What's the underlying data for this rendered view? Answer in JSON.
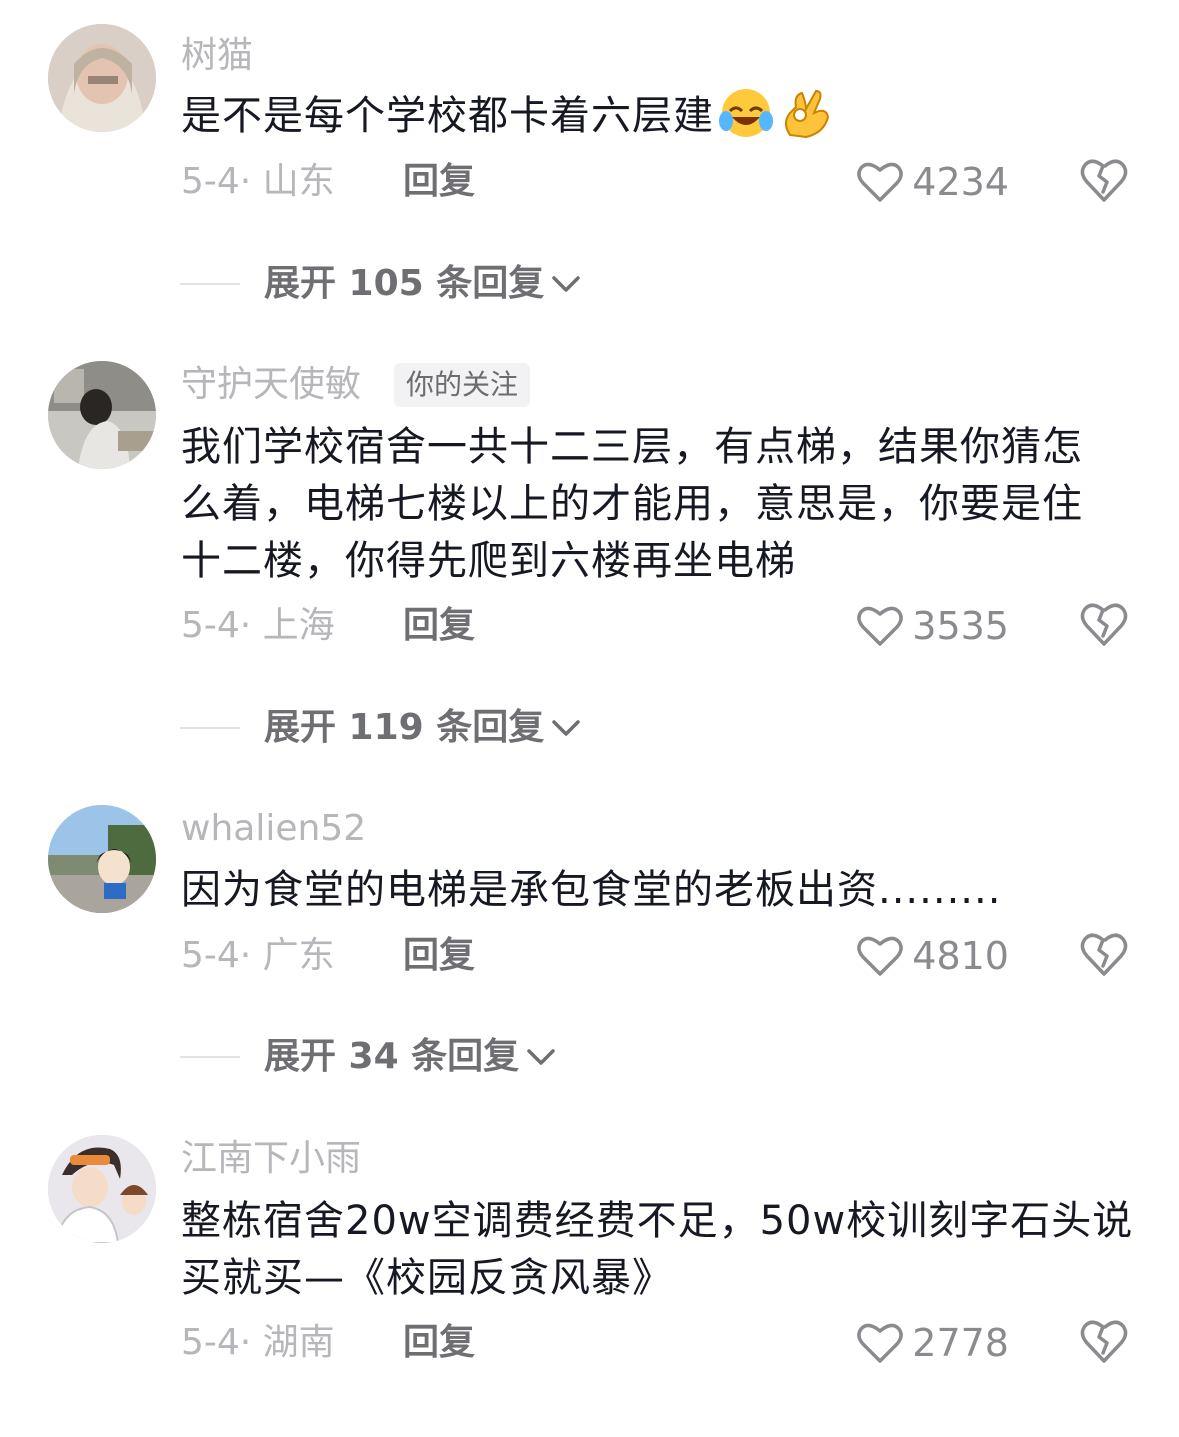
{
  "comments": [
    {
      "username": "树猫",
      "text": "是不是每个学校都卡着六层建",
      "emojis": [
        "laughing-crying-emoji",
        "ok-hand-emoji"
      ],
      "date_location": "5-4· 山东",
      "reply_label": "回复",
      "likes": "4234",
      "expand_label": "展开 105 条回复"
    },
    {
      "username": "守护天使敏",
      "badge": "你的关注",
      "text": "我们学校宿舍一共十二三层，有点梯，结果你猜怎么着，电梯七楼以上的才能用，意思是，你要是住十二楼，你得先爬到六楼再坐电梯",
      "date_location": "5-4· 上海",
      "reply_label": "回复",
      "likes": "3535",
      "expand_label": "展开 119 条回复"
    },
    {
      "username": "whalien52",
      "text": "因为食堂的电梯是承包食堂的老板出资.........",
      "date_location": "5-4· 广东",
      "reply_label": "回复",
      "likes": "4810",
      "expand_label": "展开 34 条回复"
    },
    {
      "username": "江南下小雨",
      "text": "整栋宿舍20w空调费经费不足，50w校训刻字石头说买就买—《校园反贪风暴》",
      "date_location": "5-4· 湖南",
      "reply_label": "回复",
      "likes": "2778"
    }
  ],
  "colors": {
    "text_primary": "#161823",
    "text_secondary": "#b6b6bb",
    "reply": "#6e6e73",
    "badge_bg": "#f2f2f4"
  },
  "icons": {
    "like": "heart-outline-icon",
    "dislike": "broken-heart-icon",
    "expand": "chevron-down-icon"
  }
}
